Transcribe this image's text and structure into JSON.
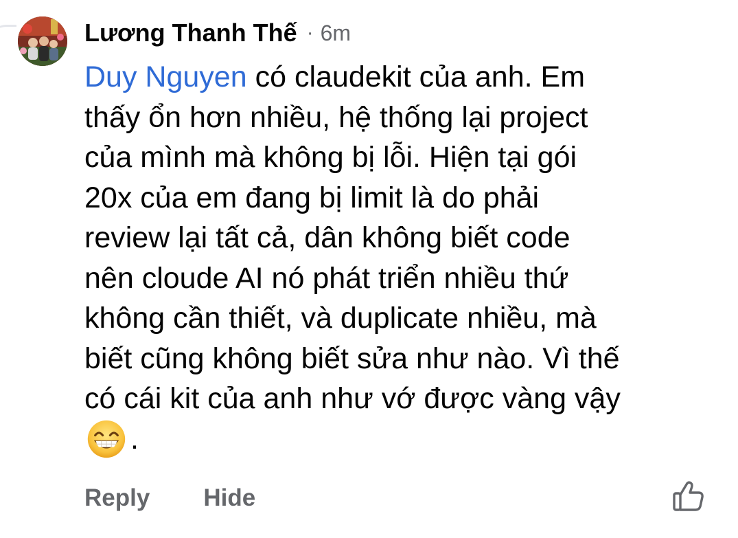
{
  "comment": {
    "author": "Lương Thanh Thế",
    "separator": "·",
    "time": "6m",
    "mention": "Duy Nguyen",
    "lines": [
      " có claudekit của anh. Em",
      "thấy ổn hơn nhiều, hệ thống lại project",
      "của mình mà không bị lỗi. Hiện tại gói",
      "20x của em đang bị limit là do phải",
      "review lại tất cả, dân không biết code",
      "nên cloude AI nó phát triển nhiều thứ",
      "không cần thiết, và duplicate nhiều, mà",
      "biết cũng không biết sửa như nào. Vì thế",
      "có cái kit của anh như vớ được vàng vậy"
    ],
    "emoji": "grinning-face-with-smiling-eyes",
    "end_punct": "."
  },
  "actions": {
    "reply": "Reply",
    "hide": "Hide",
    "like_icon": "thumbs-up-icon"
  },
  "colors": {
    "mention": "#2f6bd6",
    "secondary_text": "#65676b",
    "text": "#050505"
  }
}
